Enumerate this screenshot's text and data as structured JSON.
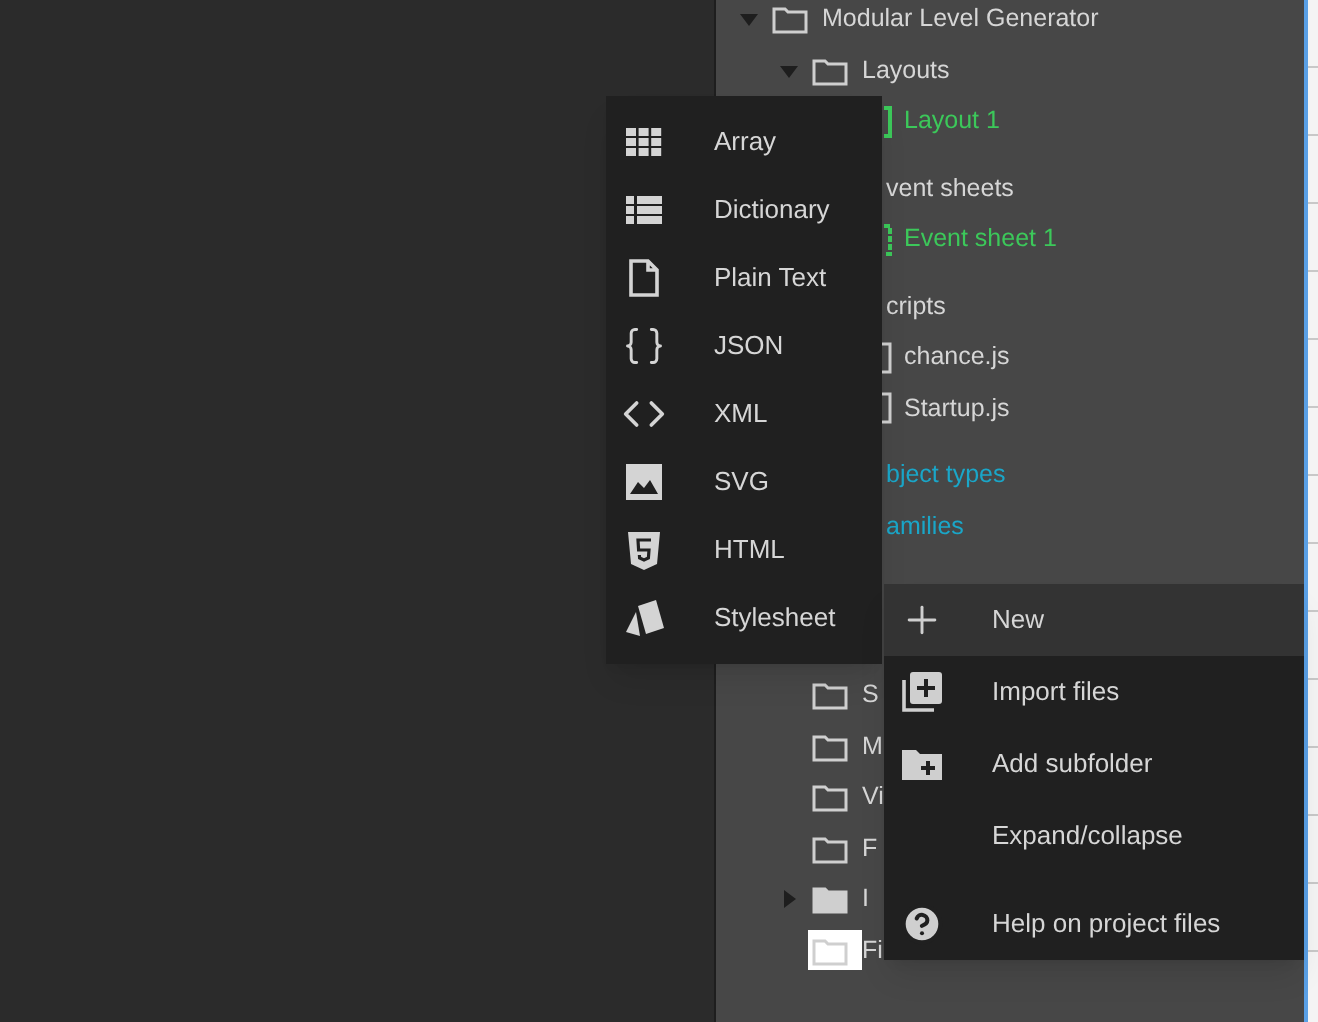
{
  "tree": [
    {
      "label": "Modular Level Generator",
      "kind": "folder",
      "expanded": true,
      "children": [
        {
          "label": "Layouts",
          "kind": "folder",
          "expanded": true,
          "children": [
            {
              "label": "Layout 1",
              "kind": "layout"
            }
          ]
        },
        {
          "label": "vent sheets",
          "kind": "folder",
          "clipped": true,
          "children": [
            {
              "label": "Event sheet 1",
              "kind": "eventsheet"
            }
          ]
        },
        {
          "label": "cripts",
          "kind": "folder",
          "clipped": true,
          "children": [
            {
              "label": "chance.js",
              "kind": "script"
            },
            {
              "label": "Startup.js",
              "kind": "script"
            }
          ]
        },
        {
          "label": "bject types",
          "kind": "category",
          "clipped": true
        },
        {
          "label": "amilies",
          "kind": "category",
          "clipped": true
        },
        {
          "label": "S",
          "kind": "folder"
        },
        {
          "label": "M",
          "kind": "folder"
        },
        {
          "label": "Vi",
          "kind": "folder"
        },
        {
          "label": "F",
          "kind": "folder"
        },
        {
          "label": "I",
          "kind": "folder",
          "expanded": false,
          "filled": true
        },
        {
          "label": "Fi",
          "kind": "folder",
          "selected": true
        }
      ]
    }
  ],
  "new_submenu": [
    {
      "label": "Array",
      "kind": "array"
    },
    {
      "label": "Dictionary",
      "kind": "dictionary"
    },
    {
      "label": "Plain Text",
      "kind": "text"
    },
    {
      "label": "JSON",
      "kind": "json"
    },
    {
      "label": "XML",
      "kind": "xml"
    },
    {
      "label": "SVG",
      "kind": "svg"
    },
    {
      "label": "HTML",
      "kind": "html"
    },
    {
      "label": "Stylesheet",
      "kind": "css"
    }
  ],
  "context_menu": [
    {
      "label": "New",
      "kind": "plus",
      "selected": true
    },
    {
      "label": "Import files",
      "kind": "import",
      "selected": false
    },
    {
      "label": "Add subfolder",
      "kind": "add-folder",
      "selected": false
    },
    {
      "label": "Expand/collapse",
      "kind": "none",
      "selected": false
    },
    {
      "label": "Help on project files",
      "kind": "help",
      "selected": false
    }
  ]
}
